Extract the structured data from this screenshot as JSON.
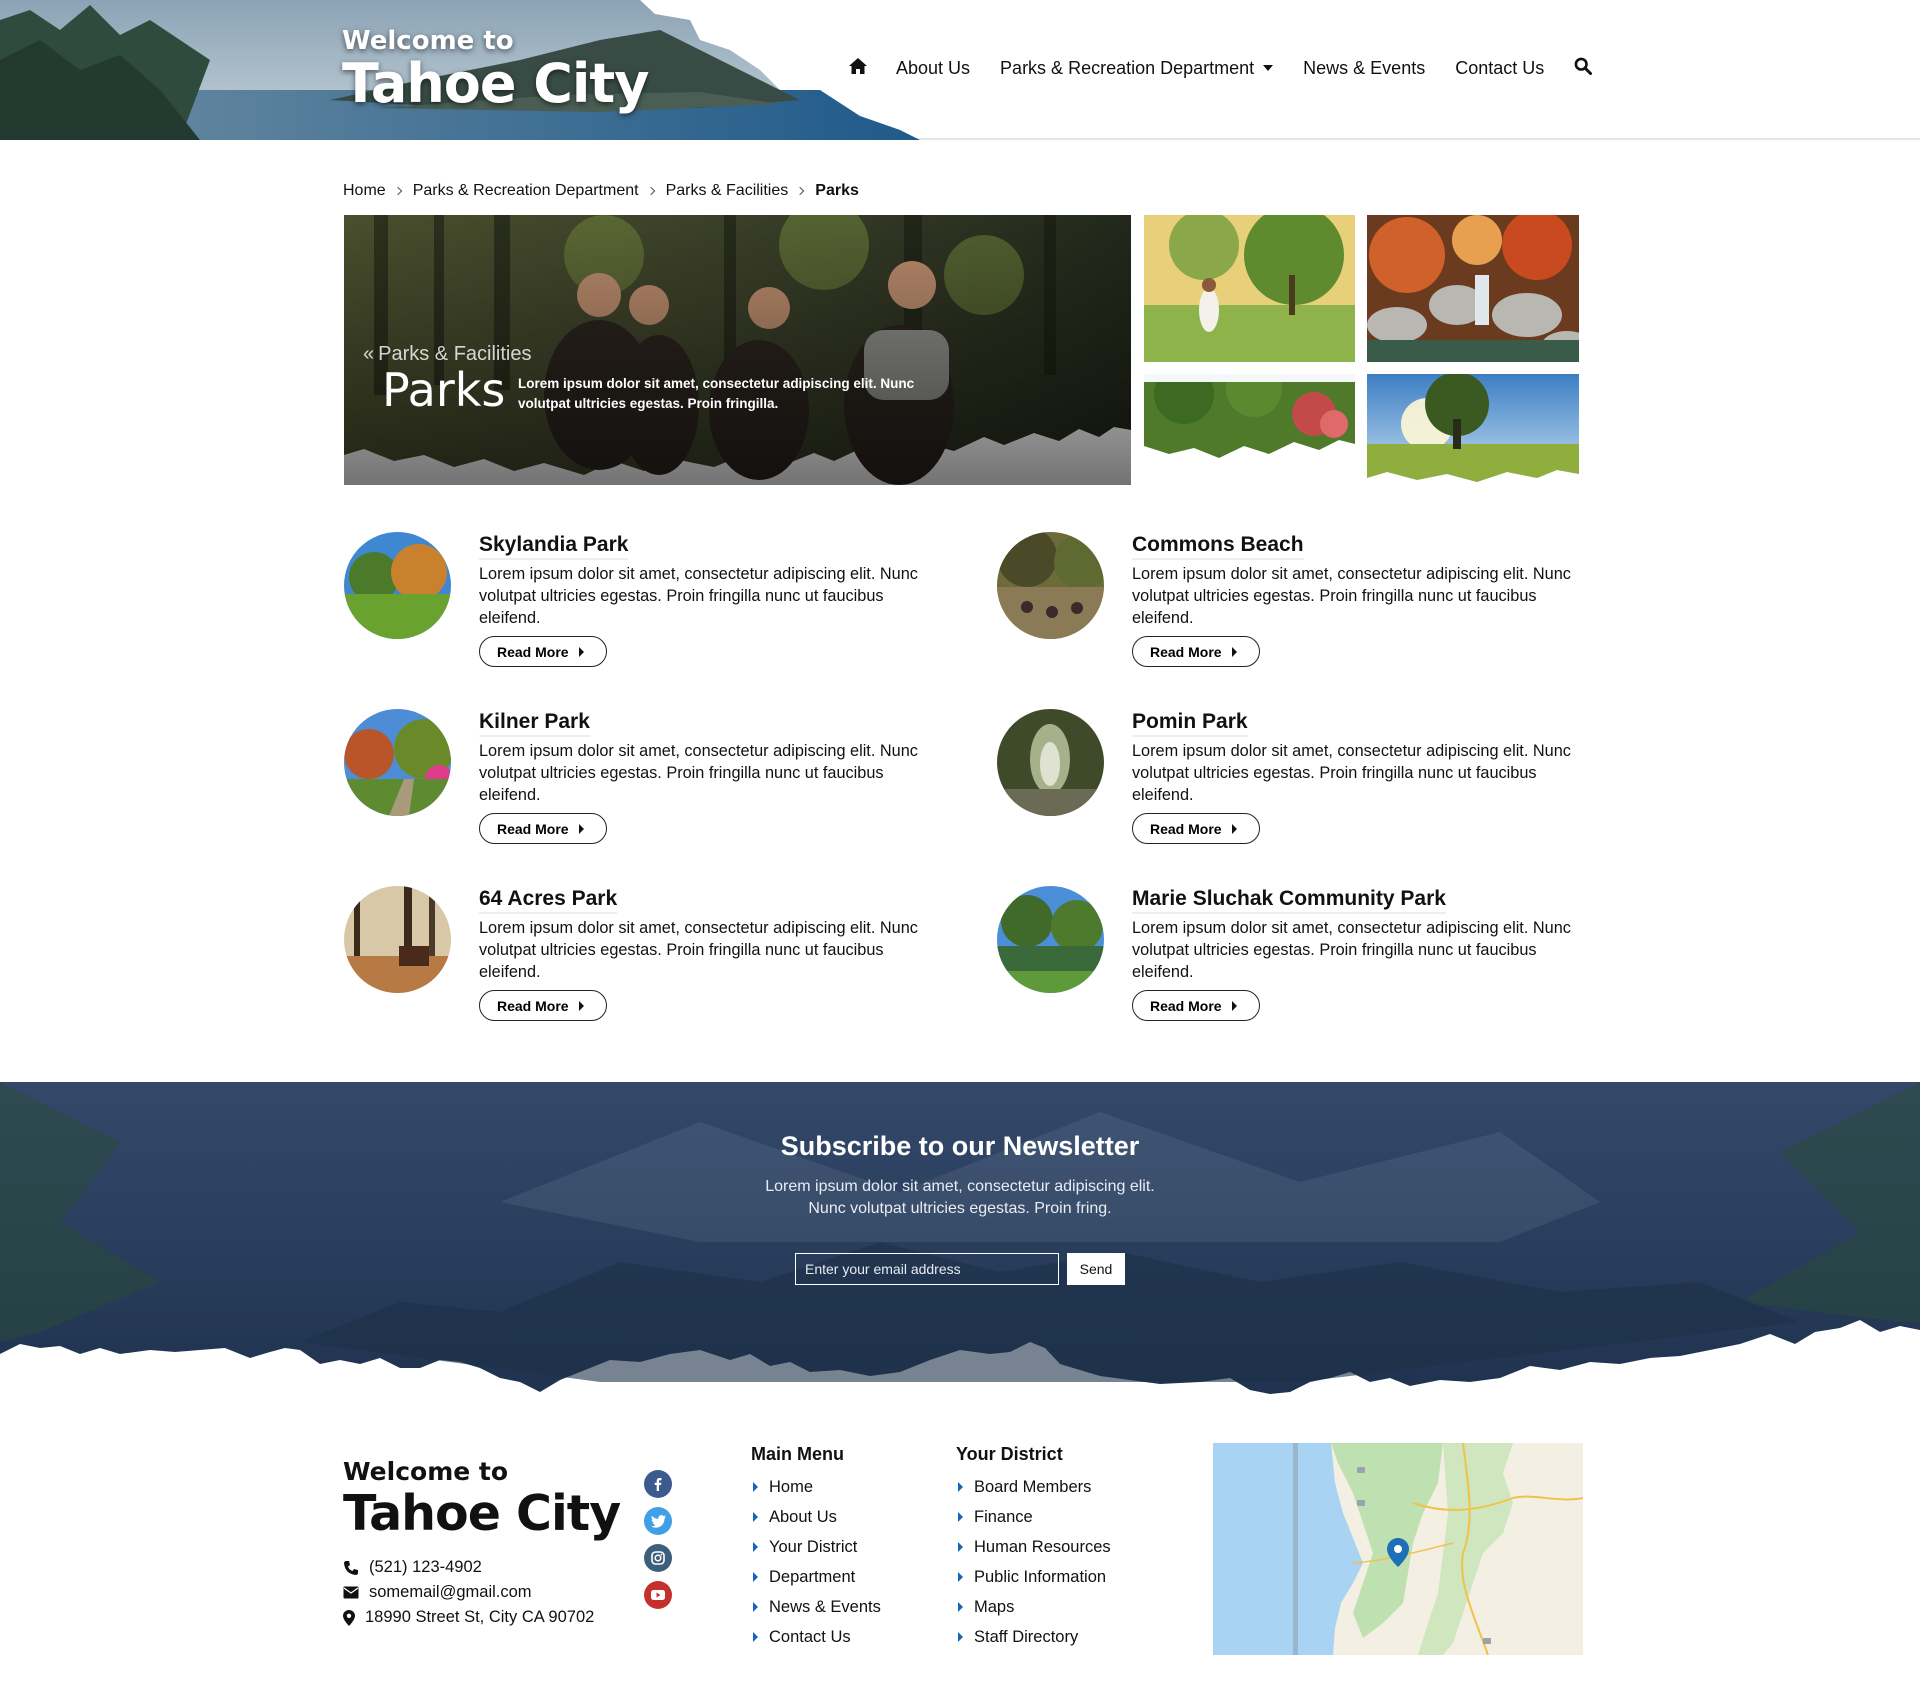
{
  "header": {
    "brand_small": "Welcome to",
    "brand_big": "Tahoe City",
    "nav": [
      {
        "label": "About Us"
      },
      {
        "label": "Parks & Recreation Department"
      },
      {
        "label": "News & Events"
      },
      {
        "label": "Contact Us"
      }
    ]
  },
  "breadcrumb": [
    "Home",
    "Parks & Recreation Department",
    "Parks & Facilities",
    "Parks"
  ],
  "hero": {
    "back_label": "Parks & Facilities",
    "title": "Parks",
    "description": "Lorem ipsum dolor sit amet, consectetur adipiscing elit. Nunc volutpat ultricies egestas. Proin fringilla."
  },
  "parks": [
    {
      "name": "Skylandia Park",
      "text": "Lorem ipsum dolor sit amet, consectetur adipiscing elit. Nunc volutpat ultricies egestas. Proin fringilla nunc ut faucibus eleifend.",
      "button": "Read More"
    },
    {
      "name": "Commons Beach",
      "text": "Lorem ipsum dolor sit amet, consectetur adipiscing elit. Nunc volutpat ultricies egestas. Proin fringilla nunc ut faucibus eleifend.",
      "button": "Read More"
    },
    {
      "name": "Kilner Park",
      "text": "Lorem ipsum dolor sit amet, consectetur adipiscing elit. Nunc volutpat ultricies egestas. Proin fringilla nunc ut faucibus eleifend.",
      "button": "Read More"
    },
    {
      "name": "Pomin Park",
      "text": "Lorem ipsum dolor sit amet, consectetur adipiscing elit. Nunc volutpat ultricies egestas. Proin fringilla nunc ut faucibus eleifend.",
      "button": "Read More"
    },
    {
      "name": "64 Acres Park",
      "text": "Lorem ipsum dolor sit amet, consectetur adipiscing elit. Nunc volutpat ultricies egestas. Proin fringilla nunc ut faucibus eleifend.",
      "button": "Read More"
    },
    {
      "name": "Marie Sluchak Community Park",
      "text": "Lorem ipsum dolor sit amet, consectetur adipiscing elit. Nunc volutpat ultricies egestas. Proin fringilla nunc ut faucibus eleifend.",
      "button": "Read More"
    }
  ],
  "newsletter": {
    "title": "Subscribe to our Newsletter",
    "text_line1": "Lorem ipsum dolor sit amet, consectetur adipiscing elit.",
    "text_line2": "Nunc volutpat ultricies egestas. Proin fring.",
    "email_placeholder": "Enter your email address",
    "send_label": "Send"
  },
  "footer": {
    "brand_small": "Welcome to",
    "brand_big": "Tahoe City",
    "phone": "(521) 123-4902",
    "email": "somemail@gmail.com",
    "address": "18990 Street St, City CA 90702",
    "social": [
      {
        "icon": "facebook-icon",
        "color": "#3b5b8f"
      },
      {
        "icon": "twitter-icon",
        "color": "#3fa0e6"
      },
      {
        "icon": "instagram-icon",
        "color": "#3e5f7c"
      },
      {
        "icon": "youtube-icon",
        "color": "#c4302b"
      }
    ],
    "main_menu": {
      "title": "Main Menu",
      "items": [
        "Home",
        "About Us",
        "Your District",
        "Department",
        "News & Events",
        "Contact Us"
      ]
    },
    "district_menu": {
      "title": "Your District",
      "items": [
        "Board Members",
        "Finance",
        "Human Resources",
        "Public Information",
        "Maps",
        "Staff Directory"
      ]
    }
  },
  "colors": {
    "accent": "#1565c0",
    "newsletter_bg": "#2b3f5c"
  }
}
